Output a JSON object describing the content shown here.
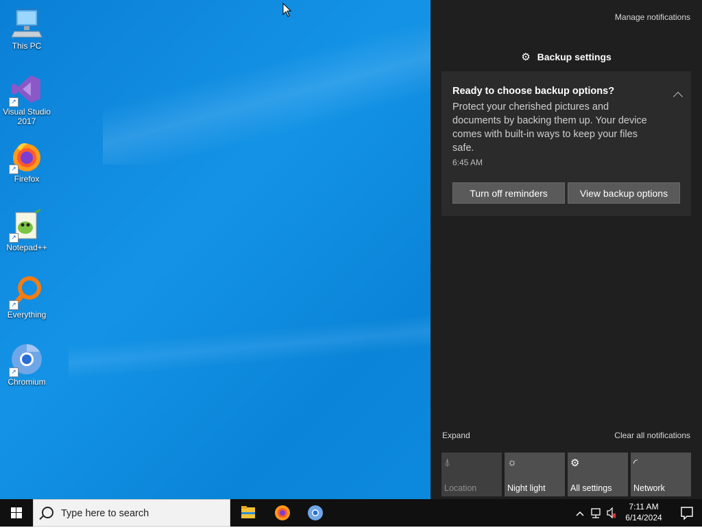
{
  "desktop": {
    "icons": [
      {
        "label": "This PC",
        "icon": "this-pc-icon"
      },
      {
        "label": "Visual Studio 2017",
        "icon": "visual-studio-icon"
      },
      {
        "label": "Firefox",
        "icon": "firefox-icon"
      },
      {
        "label": "Notepad++",
        "icon": "notepadpp-icon"
      },
      {
        "label": "Everything",
        "icon": "everything-icon"
      },
      {
        "label": "Chromium",
        "icon": "chromium-icon"
      }
    ]
  },
  "action_center": {
    "manage_label": "Manage notifications",
    "app_name": "Backup settings",
    "notification": {
      "title": "Ready to choose backup options?",
      "body": "Protect your cherished pictures and documents by backing them up. Your device comes with built-in ways to keep your files safe.",
      "time": "6:45 AM",
      "button_1": "Turn off reminders",
      "button_2": "View backup options"
    },
    "expand_label": "Expand",
    "clear_label": "Clear all notifications",
    "quick_actions": [
      {
        "label": "Location",
        "icon": "location-icon",
        "enabled": false
      },
      {
        "label": "Night light",
        "icon": "night-light-icon",
        "enabled": true
      },
      {
        "label": "All settings",
        "icon": "settings-icon",
        "enabled": true
      },
      {
        "label": "Network",
        "icon": "network-icon",
        "enabled": true
      }
    ]
  },
  "taskbar": {
    "search_placeholder": "Type here to search",
    "time": "7:11 AM",
    "date": "6/14/2024",
    "pinned": [
      "file-explorer-icon",
      "firefox-icon",
      "chromium-icon"
    ]
  },
  "colors": {
    "desktop_blue": "#0a84d8",
    "action_center_bg": "#1f1f1f",
    "card_bg": "#2b2b2b",
    "button_bg": "#5a5a5a"
  }
}
